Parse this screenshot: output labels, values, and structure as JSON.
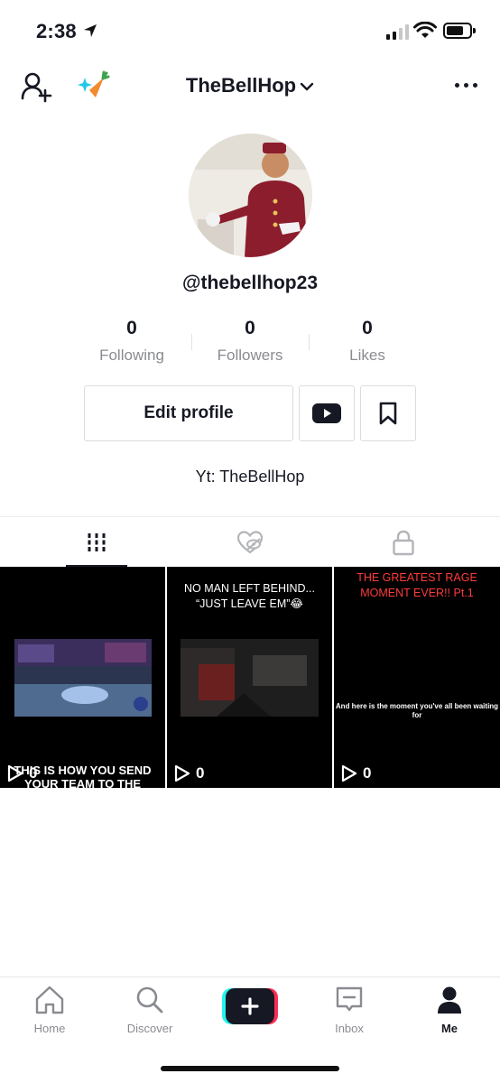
{
  "status_bar": {
    "time": "2:38",
    "icons": [
      "location-arrow-icon",
      "signal-icon",
      "wifi-icon",
      "battery-icon"
    ]
  },
  "header": {
    "username": "TheBellHop",
    "icons": [
      "add-user-icon",
      "carrot-sparkle-icon",
      "chevron-down-icon",
      "more-icon"
    ]
  },
  "profile": {
    "handle": "@thebellhop23",
    "stats": [
      {
        "value": "0",
        "label": "Following"
      },
      {
        "value": "0",
        "label": "Followers"
      },
      {
        "value": "0",
        "label": "Likes"
      }
    ],
    "edit_label": "Edit profile",
    "bio": "Yt: TheBellHop"
  },
  "tabs": [
    {
      "icon": "grid-icon",
      "active": true
    },
    {
      "icon": "liked-hidden-icon",
      "active": false
    },
    {
      "icon": "lock-icon",
      "active": false
    }
  ],
  "videos": [
    {
      "caption_top": "",
      "caption_bottom": "THIS IS HOW YOU SEND YOUR TEAM TO THE",
      "views": "0"
    },
    {
      "caption_top": "NO MAN LEFT BEHIND... “JUST LEAVE EM”😂",
      "views": "0"
    },
    {
      "caption_top": "THE GREATEST RAGE MOMENT EVER!! Pt.1",
      "caption_mid": "And here is the moment you've all been waiting for",
      "views": "0"
    }
  ],
  "bottom_nav": [
    {
      "label": "Home",
      "icon": "home-icon"
    },
    {
      "label": "Discover",
      "icon": "search-icon"
    },
    {
      "label": "",
      "icon": "plus-icon"
    },
    {
      "label": "Inbox",
      "icon": "inbox-icon"
    },
    {
      "label": "Me",
      "icon": "person-icon",
      "active": true
    }
  ],
  "colors": {
    "accent_red": "#fe2c55",
    "accent_cyan": "#25f4ee",
    "text_primary": "#161823",
    "text_secondary": "#8a8b91",
    "title_red": "#ff3b3b"
  }
}
